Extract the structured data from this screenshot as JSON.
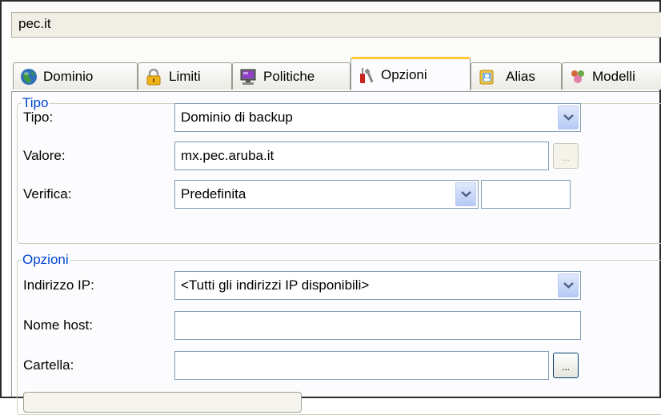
{
  "domain_bar": {
    "title": "pec.it"
  },
  "tabs": [
    {
      "label": "Dominio",
      "icon": "globe-icon"
    },
    {
      "label": "Limiti",
      "icon": "lock-icon"
    },
    {
      "label": "Politiche",
      "icon": "monitor-icon"
    },
    {
      "label": "Opzioni",
      "icon": "tools-icon",
      "active": true
    },
    {
      "label": "Alias",
      "icon": "address-book-icon"
    },
    {
      "label": "Modelli",
      "icon": "users-icon"
    }
  ],
  "tipo_group": {
    "legend": "Tipo",
    "tipo_label": "Tipo:",
    "tipo_value": "Dominio di backup",
    "valore_label": "Valore:",
    "valore_value": "mx.pec.aruba.it",
    "verifica_label": "Verifica:",
    "verifica_value": "Predefinita",
    "verifica_extra_value": "",
    "browse_label": "..."
  },
  "opzioni_group": {
    "legend": "Opzioni",
    "ip_label": "Indirizzo IP:",
    "ip_value": "<Tutti gli indirizzi IP disponibili>",
    "host_label": "Nome host:",
    "host_value": "",
    "cartella_label": "Cartella:",
    "cartella_value": "",
    "browse_label": "..."
  },
  "colors": {
    "legend": "#0046d5",
    "active_tab_accent": "#ffc83c",
    "field_border": "#7f9db9"
  }
}
